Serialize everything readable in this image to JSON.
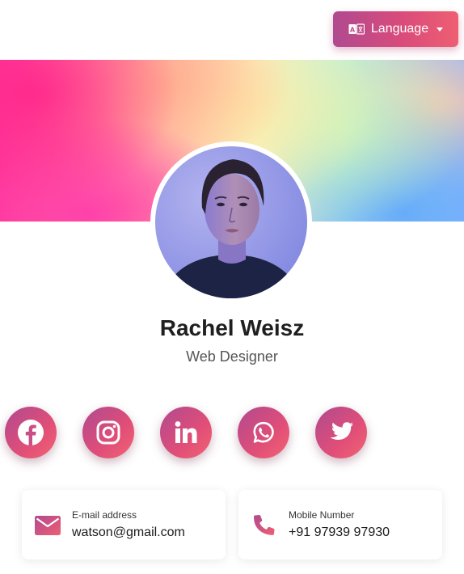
{
  "language_button": {
    "label": "Language",
    "icon": "translate-icon"
  },
  "profile": {
    "name": "Rachel Weisz",
    "role": "Web Designer"
  },
  "social": [
    {
      "name": "facebook",
      "icon": "facebook-icon"
    },
    {
      "name": "instagram",
      "icon": "instagram-icon"
    },
    {
      "name": "linkedin",
      "icon": "linkedin-icon"
    },
    {
      "name": "whatsapp",
      "icon": "whatsapp-icon"
    },
    {
      "name": "twitter",
      "icon": "twitter-icon"
    }
  ],
  "contacts": {
    "email": {
      "label": "E-mail address",
      "value": "watson@gmail.com",
      "icon": "mail-icon"
    },
    "phone": {
      "label": "Mobile Number",
      "value": "+91 97939 97930",
      "icon": "phone-icon"
    }
  },
  "colors": {
    "accent_start": "#b04a90",
    "accent_end": "#f26472"
  }
}
